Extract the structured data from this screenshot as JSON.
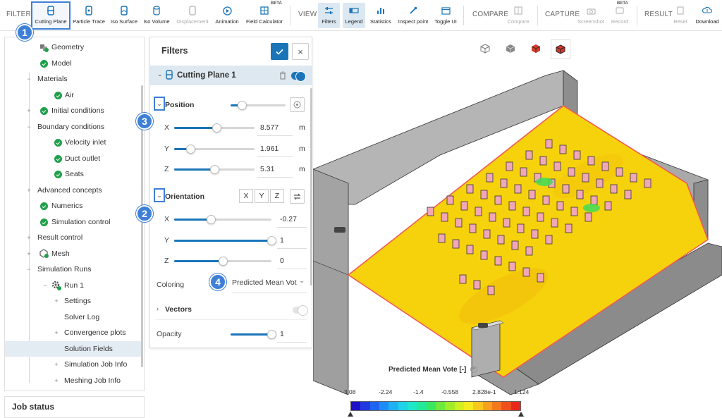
{
  "toolbar": {
    "groups": {
      "filters": "FILTERS",
      "view": "VIEW",
      "compare": "COMPARE",
      "capture": "CAPTURE",
      "result": "RESULT"
    },
    "filters": [
      {
        "label": "Cutting Plane",
        "icon": "cutting-plane-icon"
      },
      {
        "label": "Particle Trace",
        "icon": "particle-trace-icon"
      },
      {
        "label": "Iso Surface",
        "icon": "iso-surface-icon"
      },
      {
        "label": "Iso Volume",
        "icon": "iso-volume-icon"
      },
      {
        "label": "Displacement",
        "icon": "displacement-icon"
      },
      {
        "label": "Animation",
        "icon": "play-icon"
      },
      {
        "label": "Field Calculator",
        "icon": "calculator-icon",
        "badge": "BETA"
      }
    ],
    "view": [
      {
        "label": "Filters",
        "icon": "sliders-icon"
      },
      {
        "label": "Legend",
        "icon": "legend-icon"
      },
      {
        "label": "Statistics",
        "icon": "statistics-icon"
      },
      {
        "label": "Inspect point",
        "icon": "pipette-icon"
      },
      {
        "label": "Toggle UI",
        "icon": "window-icon"
      }
    ],
    "compare": [
      {
        "label": "Compare",
        "icon": "compare-icon"
      }
    ],
    "capture": [
      {
        "label": "Screenshot",
        "icon": "camera-icon"
      },
      {
        "label": "Record",
        "icon": "record-icon",
        "badge": "BETA"
      }
    ],
    "result": [
      {
        "label": "Reset",
        "icon": "reset-icon"
      },
      {
        "label": "Download",
        "icon": "download-icon"
      }
    ]
  },
  "tree": {
    "items": [
      {
        "label": "Geometry"
      },
      {
        "label": "Model"
      },
      {
        "label": "Materials"
      },
      {
        "label": "Air"
      },
      {
        "label": "Initial conditions"
      },
      {
        "label": "Boundary conditions"
      },
      {
        "label": "Velocity inlet"
      },
      {
        "label": "Duct outlet"
      },
      {
        "label": "Seats"
      },
      {
        "label": "Advanced concepts"
      },
      {
        "label": "Numerics"
      },
      {
        "label": "Simulation control"
      },
      {
        "label": "Result control"
      },
      {
        "label": "Mesh"
      },
      {
        "label": "Simulation Runs"
      },
      {
        "label": "Run 1"
      },
      {
        "label": "Settings"
      },
      {
        "label": "Solver Log"
      },
      {
        "label": "Convergence plots"
      },
      {
        "label": "Solution Fields"
      },
      {
        "label": "Simulation Job Info"
      },
      {
        "label": "Meshing Job Info"
      }
    ],
    "job_status": "Job status"
  },
  "badges": [
    "1",
    "2",
    "3",
    "4"
  ],
  "filters_panel": {
    "title": "Filters",
    "close": "×",
    "cutting_plane": "Cutting Plane 1",
    "position": {
      "label": "Position",
      "level": 0.2,
      "x": {
        "label": "X",
        "value": "8.577",
        "unit": "m",
        "level": 0.53
      },
      "y": {
        "label": "Y",
        "value": "1.961",
        "unit": "m",
        "level": 0.2
      },
      "z": {
        "label": "Z",
        "value": "5.31",
        "unit": "m",
        "level": 0.5
      }
    },
    "orientation": {
      "label": "Orientation",
      "axis_x": "X",
      "axis_y": "Y",
      "axis_z": "Z",
      "x": {
        "label": "X",
        "value": "-0.27",
        "level": 0.38
      },
      "y": {
        "label": "Y",
        "value": "1",
        "level": 1.0
      },
      "z": {
        "label": "Z",
        "value": "0",
        "level": 0.5
      }
    },
    "coloring": {
      "label": "Coloring",
      "value": "Predicted Mean Vot"
    },
    "vectors": {
      "label": "Vectors"
    },
    "opacity": {
      "label": "Opacity",
      "value": "1",
      "level": 1.0
    }
  },
  "legend": {
    "title": "Predicted Mean Vote [-]",
    "ticks": [
      "-3.08",
      "-2.24",
      "-1.4",
      "-0.558",
      "2.828e-1",
      "1.124"
    ],
    "colors": [
      "#1f10c9",
      "#2038e0",
      "#1f64f0",
      "#1e8cf8",
      "#1eb2f5",
      "#1ed2e8",
      "#1ee8c8",
      "#22e89a",
      "#3ae660",
      "#6ee83a",
      "#a0ec28",
      "#d0ee20",
      "#f4ec1e",
      "#f8c81e",
      "#f8a01e",
      "#f4781e",
      "#f0501e",
      "#e8281c"
    ]
  },
  "colors": {
    "accent": "#1a75b8",
    "badge": "#3f7fd6",
    "floor": "#f5d20c",
    "walls": "#b8b8b8",
    "outline": "#f05a55"
  }
}
